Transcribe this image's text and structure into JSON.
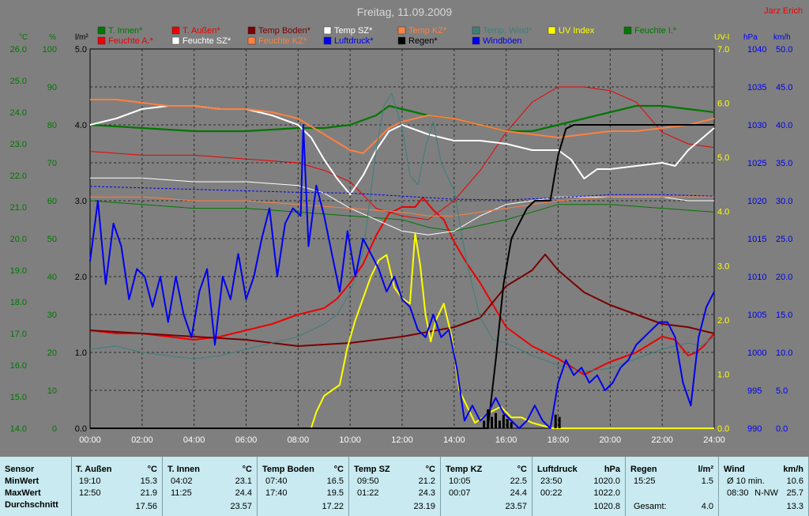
{
  "header": {
    "title": "Freitag, 11.09.2009",
    "author": "Jarz Erich"
  },
  "colors": {
    "t_innen": "#007700",
    "t_aussen": "#ee0000",
    "temp_boden": "#7a0000",
    "temp_sz": "#ffffff",
    "temp_kz": "#ff8040",
    "temp_wind": "#3c7f7a",
    "uv": "#ffff00",
    "feuchte_i": "#007700",
    "feuchte_a": "#ee0000",
    "feuchte_sz": "#ffffff",
    "feuchte_kz": "#ff8040",
    "luftdruck": "#0000ee",
    "regen": "#000000",
    "windboeen": "#0000ee"
  },
  "chart_data": {
    "type": "line",
    "title": "Freitag, 11.09.2009",
    "x_ticks": [
      "00:00",
      "02:00",
      "04:00",
      "06:00",
      "08:00",
      "10:00",
      "12:00",
      "14:00",
      "16:00",
      "18:00",
      "20:00",
      "22:00",
      "24:00"
    ],
    "xlim": [
      0,
      24
    ],
    "grid": true,
    "axes": {
      "temp": {
        "unit": "°C",
        "ylim": [
          14,
          26
        ],
        "ticks": [
          "26.0",
          "25.0",
          "24.0",
          "23.0",
          "22.0",
          "21.0",
          "20.0",
          "19.0",
          "18.0",
          "17.0",
          "16.0",
          "15.0",
          "14.0"
        ]
      },
      "hum": {
        "unit": "%",
        "ylim": [
          0,
          100
        ],
        "ticks": [
          "100",
          "90",
          "80",
          "70",
          "60",
          "50",
          "40",
          "30",
          "20",
          "10",
          "0"
        ]
      },
      "rain": {
        "unit": "l/m²",
        "ylim": [
          0,
          5
        ],
        "ticks": [
          "5.0",
          "4.0",
          "3.0",
          "2.0",
          "1.0",
          "0.0"
        ]
      },
      "uv": {
        "unit": "UV-I",
        "ylim": [
          0,
          7
        ],
        "ticks": [
          "7.0",
          "6.0",
          "5.0",
          "4.0",
          "3.0",
          "2.0",
          "1.0",
          "0.0"
        ]
      },
      "press": {
        "unit": "hPa",
        "ylim": [
          990,
          1040
        ],
        "ticks": [
          "1040",
          "1035",
          "1030",
          "1025",
          "1020",
          "1015",
          "1010",
          "1005",
          "1000",
          "995",
          "990"
        ]
      },
      "wind": {
        "unit": "km/h",
        "ylim": [
          0,
          50
        ],
        "ticks": [
          "50.0",
          "45.0",
          "40.0",
          "35.0",
          "30.0",
          "25.0",
          "20.0",
          "15.0",
          "10.0",
          "5.0",
          "0.0"
        ]
      }
    },
    "legend": [
      {
        "name": "T. Innen*",
        "color": "#007700"
      },
      {
        "name": "T. Außen*",
        "color": "#ee0000"
      },
      {
        "name": "Temp Boden*",
        "color": "#7a0000"
      },
      {
        "name": "Temp SZ*",
        "color": "#ffffff"
      },
      {
        "name": "Temp KZ*",
        "color": "#ff8040"
      },
      {
        "name": "Temp. Wind*",
        "color": "#3c7f7a"
      },
      {
        "name": "UV Index",
        "color": "#ffff00"
      },
      {
        "name": "Feuchte I.*",
        "color": "#007700"
      },
      {
        "name": "Feuchte A.*",
        "color": "#ee0000"
      },
      {
        "name": "Feuchte SZ*",
        "color": "#ffffff"
      },
      {
        "name": "Feuchte KZ*",
        "color": "#ff8040"
      },
      {
        "name": "Luftdruck*",
        "color": "#0000ee"
      },
      {
        "name": "Regen*",
        "color": "#000000"
      },
      {
        "name": "Windböen",
        "color": "#0000ee"
      }
    ],
    "series": [
      {
        "name": "T. Innen*",
        "axis": "temp",
        "color": "#007700",
        "width": 2.2,
        "x": [
          0,
          2,
          4,
          6,
          8,
          9,
          10,
          11,
          11.5,
          12,
          13,
          14,
          15,
          16,
          17,
          18,
          19,
          20,
          21,
          22,
          23,
          24
        ],
        "y": [
          23.6,
          23.5,
          23.4,
          23.4,
          23.5,
          23.5,
          23.6,
          23.9,
          24.2,
          24.1,
          23.9,
          23.8,
          23.6,
          23.4,
          23.4,
          23.6,
          23.8,
          24.0,
          24.2,
          24.2,
          24.1,
          24.0
        ]
      },
      {
        "name": "Feuchte I.*",
        "axis": "hum",
        "color": "#007700",
        "width": 1,
        "x": [
          0,
          2,
          4,
          6,
          8,
          10,
          12,
          13,
          14,
          16,
          18,
          20,
          22,
          24
        ],
        "y": [
          60,
          59,
          58,
          58,
          57,
          56,
          55,
          53,
          52,
          55,
          59,
          59,
          58,
          57
        ]
      },
      {
        "name": "T. Außen*",
        "axis": "temp",
        "color": "#ee0000",
        "width": 2,
        "x": [
          0,
          1,
          2,
          3,
          4,
          5,
          6,
          7,
          8,
          9,
          9.5,
          10,
          10.5,
          11,
          11.5,
          12,
          12.5,
          12.8,
          13.2,
          13.6,
          14,
          14.5,
          15,
          15.5,
          16,
          17,
          18,
          19,
          20,
          21,
          22,
          22.5,
          23,
          23.3,
          23.6,
          24
        ],
        "y": [
          17.1,
          17.0,
          17.0,
          16.9,
          16.8,
          16.9,
          17.1,
          17.3,
          17.6,
          17.8,
          18.1,
          18.6,
          19.2,
          20.1,
          20.8,
          21.0,
          21.0,
          21.3,
          20.9,
          20.6,
          19.9,
          19.2,
          18.6,
          17.9,
          17.2,
          16.6,
          16.2,
          15.7,
          16.1,
          16.4,
          16.9,
          16.8,
          16.3,
          16.4,
          16.6,
          17.0
        ]
      },
      {
        "name": "Feuchte A.*",
        "axis": "hum",
        "color": "#ee0000",
        "width": 1,
        "x": [
          0,
          2,
          4,
          6,
          8,
          9,
          10,
          11,
          12,
          13,
          14,
          15,
          16,
          17,
          18,
          19,
          20,
          21,
          22,
          23,
          24
        ],
        "y": [
          73,
          72,
          72,
          71,
          70,
          68,
          65,
          58,
          56,
          55,
          60,
          68,
          78,
          86,
          90,
          90,
          89,
          86,
          78,
          75,
          74
        ]
      },
      {
        "name": "Temp Boden*",
        "axis": "temp",
        "color": "#7a0000",
        "width": 2,
        "x": [
          0,
          2,
          4,
          6,
          8,
          10,
          12,
          14,
          15,
          16,
          17,
          17.5,
          18,
          19,
          20,
          21,
          22,
          23,
          24
        ],
        "y": [
          17.1,
          17.0,
          16.9,
          16.8,
          16.6,
          16.7,
          16.9,
          17.2,
          17.5,
          18.5,
          19.0,
          19.5,
          19.0,
          18.3,
          17.9,
          17.6,
          17.3,
          17.2,
          17.0
        ]
      },
      {
        "name": "Temp SZ*",
        "axis": "temp",
        "color": "#ffffff",
        "width": 2,
        "x": [
          0,
          1,
          2,
          3,
          4,
          5,
          6,
          7,
          8,
          8.5,
          9,
          9.5,
          10,
          10.5,
          11,
          11.5,
          12,
          13,
          14,
          15,
          16,
          17,
          18,
          18.5,
          19,
          19.5,
          20,
          21,
          22,
          22.5,
          23,
          24
        ],
        "y": [
          23.6,
          23.8,
          24.1,
          24.2,
          24.2,
          24.1,
          24.1,
          23.9,
          23.6,
          23.2,
          22.5,
          21.9,
          21.4,
          22.0,
          22.8,
          23.4,
          23.6,
          23.3,
          23.1,
          23.1,
          23.0,
          22.8,
          22.8,
          22.5,
          21.9,
          22.2,
          22.2,
          22.3,
          22.4,
          22.3,
          22.8,
          23.5
        ]
      },
      {
        "name": "Feuchte SZ*",
        "axis": "hum",
        "color": "#ffffff",
        "width": 1,
        "x": [
          0,
          2,
          4,
          6,
          8,
          9,
          10,
          11,
          12,
          13,
          14,
          15,
          16,
          17,
          18,
          19,
          20,
          21,
          22,
          23,
          24
        ],
        "y": [
          66,
          66,
          65,
          65,
          64,
          62,
          58,
          55,
          52,
          51,
          52,
          56,
          59,
          60,
          61,
          61,
          61,
          61,
          61,
          60,
          60
        ]
      },
      {
        "name": "Temp KZ*",
        "axis": "temp",
        "color": "#ff8040",
        "width": 2,
        "x": [
          0,
          1,
          2,
          3,
          4,
          5,
          6,
          7,
          8,
          9,
          10,
          10.5,
          11,
          11.5,
          12,
          13,
          14,
          15,
          16,
          17,
          18,
          19,
          20,
          21,
          22,
          23,
          24
        ],
        "y": [
          24.4,
          24.4,
          24.3,
          24.2,
          24.2,
          24.1,
          24.1,
          24.0,
          23.8,
          23.3,
          22.8,
          22.7,
          23.1,
          23.5,
          23.7,
          23.9,
          23.8,
          23.6,
          23.4,
          23.3,
          23.2,
          23.3,
          23.4,
          23.4,
          23.5,
          23.6,
          23.8
        ]
      },
      {
        "name": "Feuchte KZ*",
        "axis": "hum",
        "color": "#ff8040",
        "width": 1,
        "x": [
          0,
          2,
          4,
          6,
          8,
          10,
          12,
          13,
          14,
          16,
          18,
          20,
          22,
          24
        ],
        "y": [
          61,
          61,
          60,
          60,
          59,
          58,
          57,
          56,
          56,
          58,
          60,
          61,
          61,
          61
        ]
      },
      {
        "name": "Temp. Wind*",
        "axis": "temp",
        "color": "#3c7f7a",
        "width": 1,
        "x": [
          0,
          1,
          2,
          3,
          4,
          5,
          6,
          7,
          8,
          9,
          9.5,
          10,
          10.5,
          11,
          11.3,
          11.6,
          12,
          12.3,
          12.6,
          12.9,
          13.2,
          13.5,
          14,
          14.5,
          15,
          15.5,
          16,
          17,
          18,
          19,
          20,
          21,
          22,
          23,
          23.5,
          24
        ],
        "y": [
          16.5,
          16.6,
          16.4,
          16.3,
          16.2,
          16.3,
          16.5,
          16.7,
          16.9,
          17.3,
          17.6,
          18.3,
          19.6,
          22.8,
          24.2,
          24.6,
          23.5,
          22.0,
          21.7,
          22.9,
          23.7,
          22.4,
          21.5,
          19.2,
          17.5,
          16.8,
          16.7,
          16.3,
          16.0,
          15.8,
          15.9,
          16.2,
          16.5,
          16.7,
          16.6,
          16.9
        ]
      },
      {
        "name": "Luftdruck*",
        "axis": "press",
        "color": "#0000ee",
        "width": 1,
        "dashed": true,
        "x": [
          0,
          2,
          4,
          6,
          8,
          10,
          12,
          14,
          16,
          18,
          20,
          22,
          24
        ],
        "y": [
          1021.9,
          1021.7,
          1021.5,
          1021.3,
          1021.1,
          1021.0,
          1020.6,
          1020.2,
          1020.1,
          1020.4,
          1020.8,
          1020.8,
          1020.6
        ]
      },
      {
        "name": "UV Index",
        "axis": "uv",
        "color": "#ffff00",
        "width": 2,
        "x": [
          0,
          8.5,
          8.7,
          9,
          9.3,
          9.6,
          9.9,
          10.2,
          10.5,
          10.8,
          11.1,
          11.4,
          11.7,
          12,
          12.3,
          12.5,
          12.7,
          12.9,
          13.1,
          13.3,
          13.6,
          13.9,
          14.2,
          14.5,
          14.8,
          15.1,
          15.4,
          15.8,
          16.2,
          16.6,
          17,
          17.4,
          17.8,
          24
        ],
        "y": [
          0,
          0,
          0.3,
          0.6,
          0.7,
          0.8,
          1.5,
          2.0,
          2.4,
          2.8,
          3.1,
          3.2,
          2.6,
          2.4,
          2.3,
          3.6,
          3.0,
          2.1,
          1.6,
          2.0,
          2.3,
          1.7,
          0.7,
          0.4,
          0.1,
          0.2,
          0.3,
          0.4,
          0.2,
          0.2,
          0.1,
          0.05,
          0,
          0
        ]
      },
      {
        "name": "Regen*",
        "axis": "rain",
        "color": "#000000",
        "width": 2,
        "x": [
          0,
          15.3,
          15.6,
          15.9,
          16.2,
          16.5,
          16.8,
          17.1,
          17.4,
          17.7,
          18,
          18.3,
          18.6,
          19,
          20,
          22,
          24
        ],
        "y": [
          0,
          0,
          0.9,
          1.9,
          2.5,
          2.7,
          2.9,
          3.0,
          3.0,
          3.0,
          3.6,
          3.95,
          4.0,
          4.0,
          4.0,
          4.0,
          4.0
        ]
      },
      {
        "name": "Windböen",
        "axis": "wind",
        "color": "#0000ee",
        "width": 2,
        "jagged": true,
        "x": [
          0,
          0.3,
          0.6,
          0.9,
          1.2,
          1.5,
          1.8,
          2.1,
          2.4,
          2.7,
          3.0,
          3.3,
          3.6,
          3.9,
          4.2,
          4.5,
          4.8,
          5.1,
          5.4,
          5.7,
          6.0,
          6.3,
          6.6,
          6.9,
          7.2,
          7.5,
          7.8,
          8.1,
          8.2,
          8.4,
          8.7,
          9.0,
          9.3,
          9.6,
          9.9,
          10.2,
          10.5,
          10.8,
          11.1,
          11.4,
          11.7,
          12.0,
          12.3,
          12.6,
          12.9,
          13.2,
          13.5,
          13.8,
          14.1,
          14.4,
          14.7,
          15.0,
          15.3,
          15.6,
          15.9,
          16.2,
          16.5,
          16.8,
          17.1,
          17.4,
          17.7,
          18.0,
          18.3,
          18.6,
          18.9,
          19.2,
          19.5,
          19.8,
          20.1,
          20.4,
          20.7,
          21.0,
          21.3,
          21.6,
          21.9,
          22.2,
          22.5,
          22.8,
          23.1,
          23.4,
          23.7,
          24.0
        ],
        "y": [
          22,
          30,
          19,
          27,
          24,
          17,
          21,
          20,
          16,
          20,
          14,
          20,
          15,
          12,
          18,
          21,
          11,
          20,
          17,
          23,
          17,
          20,
          25,
          29,
          20,
          27,
          29,
          28,
          40,
          24,
          32,
          28,
          23,
          18,
          26,
          20,
          25,
          23,
          21,
          18,
          20,
          17,
          16,
          13,
          12,
          15,
          12,
          13,
          8,
          1,
          3,
          1,
          2,
          4,
          2,
          1,
          0,
          1,
          3,
          1,
          0,
          6,
          9,
          7,
          8,
          6,
          7,
          5,
          6,
          8,
          9,
          11,
          12,
          13,
          14,
          14,
          12,
          6,
          3,
          12,
          16,
          18
        ]
      }
    ],
    "rain_bars": {
      "x": [
        15.15,
        15.3,
        15.45,
        15.6,
        15.75,
        15.9,
        16.05,
        16.2,
        17.9,
        18.05
      ],
      "y": [
        0.1,
        0.25,
        0.15,
        0.2,
        0.1,
        0.18,
        0.12,
        0.08,
        0.18,
        0.15
      ]
    }
  },
  "table": {
    "sensor_label": "Sensor",
    "row_labels": [
      "MinWert",
      "MaxWert",
      "Durchschnitt"
    ],
    "columns": [
      {
        "title": "T. Außen",
        "unit": "°C",
        "min_time": "19:10",
        "min": "15.3",
        "max_time": "12:50",
        "max": "21.9",
        "avg": "17.56"
      },
      {
        "title": "T. Innen",
        "unit": "°C",
        "min_time": "04:02",
        "min": "23.1",
        "max_time": "11:25",
        "max": "24.4",
        "avg": "23.57"
      },
      {
        "title": "Temp Boden",
        "unit": "°C",
        "min_time": "07:40",
        "min": "16.5",
        "max_time": "17:40",
        "max": "19.5",
        "avg": "17.22"
      },
      {
        "title": "Temp SZ",
        "unit": "°C",
        "min_time": "09:50",
        "min": "21.2",
        "max_time": "01:22",
        "max": "24.3",
        "avg": "23.19"
      },
      {
        "title": "Temp KZ",
        "unit": "°C",
        "min_time": "10:05",
        "min": "22.5",
        "max_time": "00:07",
        "max": "24.4",
        "avg": "23.57"
      },
      {
        "title": "Luftdruck",
        "unit": "hPa",
        "min_time": "23:50",
        "min": "1020.0",
        "max_time": "00:22",
        "max": "1022.0",
        "avg": "1020.8"
      },
      {
        "title": "Regen",
        "unit": "l/m²",
        "min_time": "15:25",
        "min": "1.5",
        "max_time": "",
        "max": "",
        "avg_label": "Gesamt:",
        "avg": "4.0"
      },
      {
        "title": "Wind",
        "unit": "km/h",
        "min_time": "Ø 10 min.",
        "min": "10.6",
        "max_time": "08:30",
        "max_dir": "N-NW",
        "max": "25.7",
        "avg": "13.3"
      }
    ]
  }
}
